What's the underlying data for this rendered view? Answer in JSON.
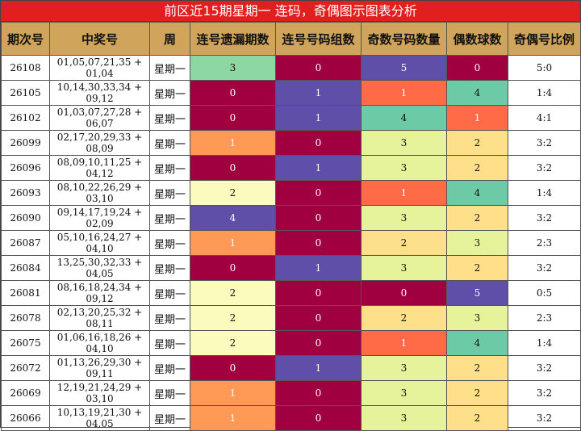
{
  "title": "前区近15期星期一 连码，奇偶图示图表分析",
  "headers": [
    "期次号",
    "中奖号",
    "周",
    "连号遗漏期数",
    "连号号码组数",
    "奇数号码数量",
    "偶数球数",
    "奇偶号比例"
  ],
  "colors": {
    "title_bg": "#e21f1f",
    "header_bg": "#d1a45b",
    "c0": "#a00040",
    "c1": "#5f4fa8",
    "c2": "#e7f39b",
    "c3": "#ffe08a",
    "c4": "#6ccba6",
    "c5": "#ff6b47",
    "c6": "#fbfbbd",
    "c7": "#ff9955",
    "c8": "#8dd7a3"
  },
  "rows": [
    {
      "issue": "26108",
      "numbers": "01,05,07,21,35 + 01,04",
      "week": "星期一",
      "miss": "3",
      "groups": "0",
      "odd": "5",
      "even": "0",
      "ratio": "5:0"
    },
    {
      "issue": "26105",
      "numbers": "10,14,30,33,34 + 09,12",
      "week": "星期一",
      "miss": "0",
      "groups": "1",
      "odd": "1",
      "even": "4",
      "ratio": "1:4"
    },
    {
      "issue": "26102",
      "numbers": "01,03,07,27,28 + 06,07",
      "week": "星期一",
      "miss": "0",
      "groups": "1",
      "odd": "4",
      "even": "1",
      "ratio": "4:1"
    },
    {
      "issue": "26099",
      "numbers": "02,17,20,29,33 + 08,09",
      "week": "星期一",
      "miss": "1",
      "groups": "0",
      "odd": "3",
      "even": "2",
      "ratio": "3:2"
    },
    {
      "issue": "26096",
      "numbers": "08,09,10,11,25 + 04,12",
      "week": "星期一",
      "miss": "0",
      "groups": "1",
      "odd": "3",
      "even": "2",
      "ratio": "3:2"
    },
    {
      "issue": "26093",
      "numbers": "08,10,22,26,29 + 03,10",
      "week": "星期一",
      "miss": "2",
      "groups": "0",
      "odd": "1",
      "even": "4",
      "ratio": "1:4"
    },
    {
      "issue": "26090",
      "numbers": "09,14,17,19,24 + 02,09",
      "week": "星期一",
      "miss": "4",
      "groups": "0",
      "odd": "3",
      "even": "2",
      "ratio": "3:2"
    },
    {
      "issue": "26087",
      "numbers": "05,10,16,24,27 + 04,10",
      "week": "星期一",
      "miss": "1",
      "groups": "0",
      "odd": "2",
      "even": "3",
      "ratio": "2:3"
    },
    {
      "issue": "26084",
      "numbers": "13,25,30,32,33 + 04,05",
      "week": "星期一",
      "miss": "0",
      "groups": "1",
      "odd": "3",
      "even": "2",
      "ratio": "3:2"
    },
    {
      "issue": "26081",
      "numbers": "08,16,18,24,34 + 09,12",
      "week": "星期一",
      "miss": "2",
      "groups": "0",
      "odd": "0",
      "even": "5",
      "ratio": "0:5"
    },
    {
      "issue": "26078",
      "numbers": "02,13,20,25,32 + 08,11",
      "week": "星期一",
      "miss": "2",
      "groups": "0",
      "odd": "2",
      "even": "3",
      "ratio": "2:3"
    },
    {
      "issue": "26075",
      "numbers": "01,06,16,18,26 + 04,10",
      "week": "星期一",
      "miss": "2",
      "groups": "0",
      "odd": "1",
      "even": "4",
      "ratio": "1:4"
    },
    {
      "issue": "26072",
      "numbers": "01,13,26,29,30 + 09,11",
      "week": "星期一",
      "miss": "0",
      "groups": "1",
      "odd": "3",
      "even": "2",
      "ratio": "3:2"
    },
    {
      "issue": "26069",
      "numbers": "12,19,21,24,29 + 03,10",
      "week": "星期一",
      "miss": "1",
      "groups": "0",
      "odd": "3",
      "even": "2",
      "ratio": "3:2"
    },
    {
      "issue": "26066",
      "numbers": "10,13,19,21,30 + 04,05",
      "week": "星期一",
      "miss": "1",
      "groups": "0",
      "odd": "3",
      "even": "2",
      "ratio": "3:2"
    }
  ]
}
